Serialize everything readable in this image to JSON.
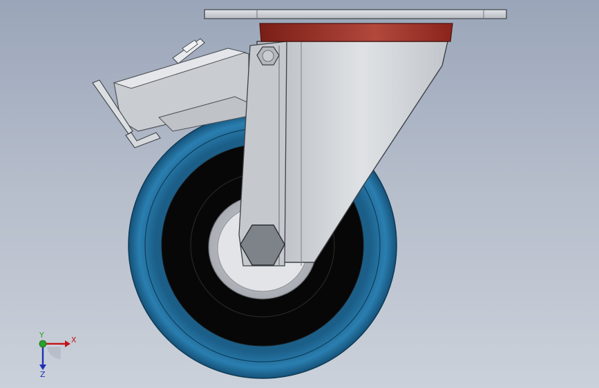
{
  "viewport": {
    "model": "swivel-caster-with-brake"
  },
  "triad": {
    "x_label": "X",
    "y_label": "Y",
    "z_label": "Z"
  },
  "colors": {
    "background_top": "#9aa5b9",
    "background_bottom": "#cbd1da",
    "tread_blue": "#1f6b9a",
    "hub_black": "#0a0a0a",
    "steel_gray": "#c8ccd1",
    "bearing_red": "#9c2a1e",
    "x_axis": "#c0161b",
    "y_axis": "#2aa12a",
    "z_axis": "#1d2fb5"
  },
  "icons": [
    "view-triad-icon",
    "hex-bolt-icon",
    "axle-nut-icon"
  ]
}
